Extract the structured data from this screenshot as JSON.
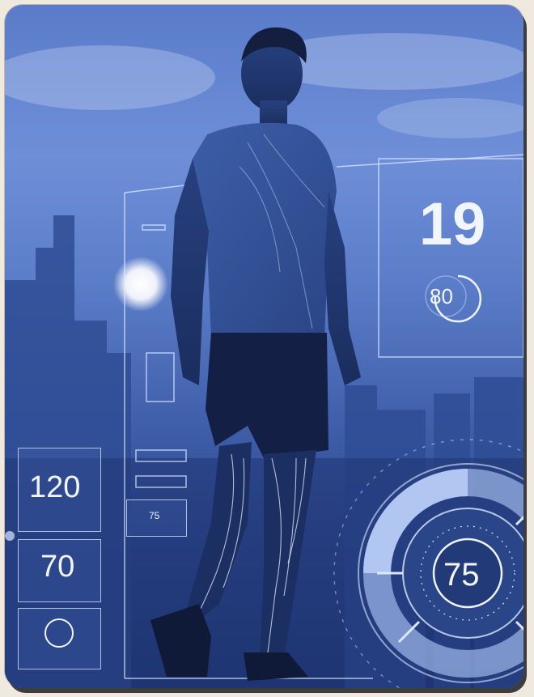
{
  "hud": {
    "big_value": "19",
    "ring_value": "80",
    "left_top_value": "120",
    "left_mid_value": "70",
    "small_box_value": "75",
    "gauge_value": "75"
  },
  "colors": {
    "tint": "#3f5ea9",
    "hud_line": "#dce8ff"
  }
}
